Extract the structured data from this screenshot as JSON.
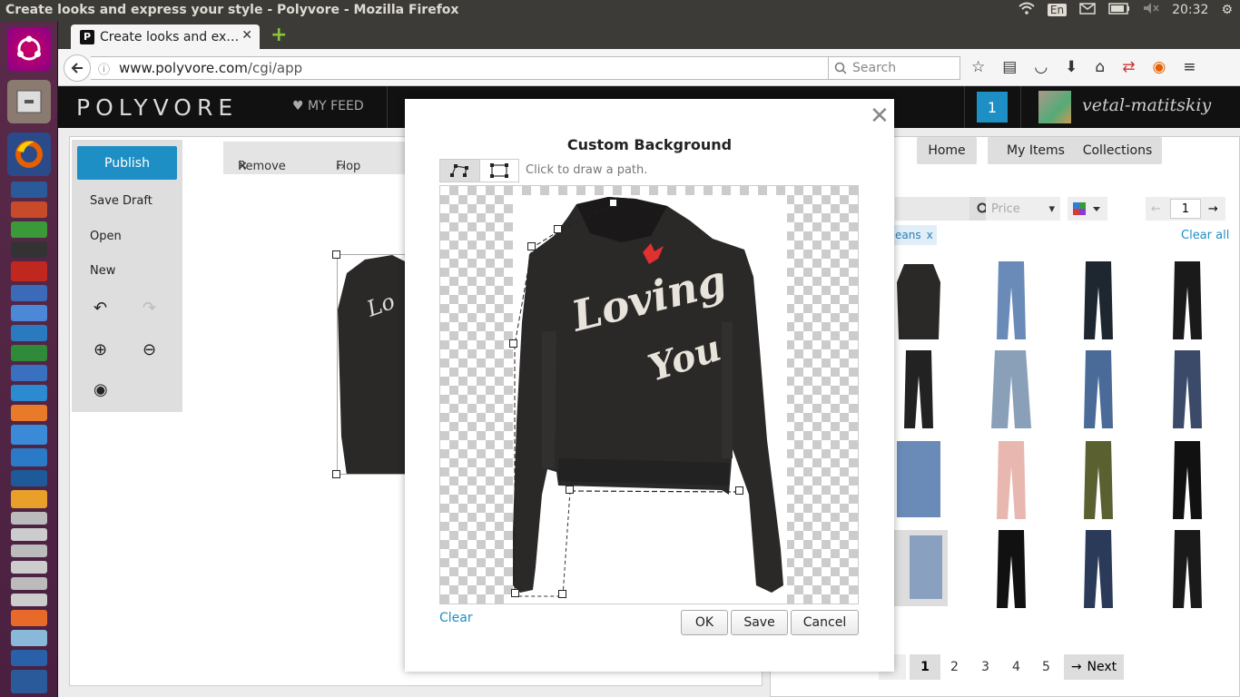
{
  "os": {
    "window_title": "Create looks and express your style - Polyvore - Mozilla Firefox",
    "lang": "En",
    "clock": "20:32"
  },
  "browser": {
    "tab_title": "Create looks and ex…",
    "tab_favicon": "P",
    "url_host": "www.polyvore.com",
    "url_path": "/cgi/app",
    "search_placeholder": "Search"
  },
  "site": {
    "logo": "POLYVORE",
    "myfeed": "MY FEED",
    "notif_count": "1",
    "username": "vetal-matitskiy"
  },
  "editor": {
    "publish": "Publish",
    "save_draft": "Save Draft",
    "open": "Open",
    "new": "New",
    "remove": "Remove",
    "flop": "Flop"
  },
  "right": {
    "tabs": [
      "Home",
      "My Items",
      "Collections"
    ],
    "price": "Price",
    "page": "1",
    "chip": "eans",
    "clear_all": "Clear all",
    "pages": [
      "1",
      "2",
      "3",
      "4",
      "5"
    ],
    "next": "Next"
  },
  "modal": {
    "title": "Custom Background",
    "hint": "Click to draw a path.",
    "jacket_text_1": "Loving",
    "jacket_text_2": "You",
    "clear": "Clear",
    "ok": "OK",
    "save": "Save",
    "cancel": "Cancel"
  },
  "colors": {
    "accent": "#1d8fc4",
    "header": "#111111",
    "jacket": "#2b2828"
  }
}
